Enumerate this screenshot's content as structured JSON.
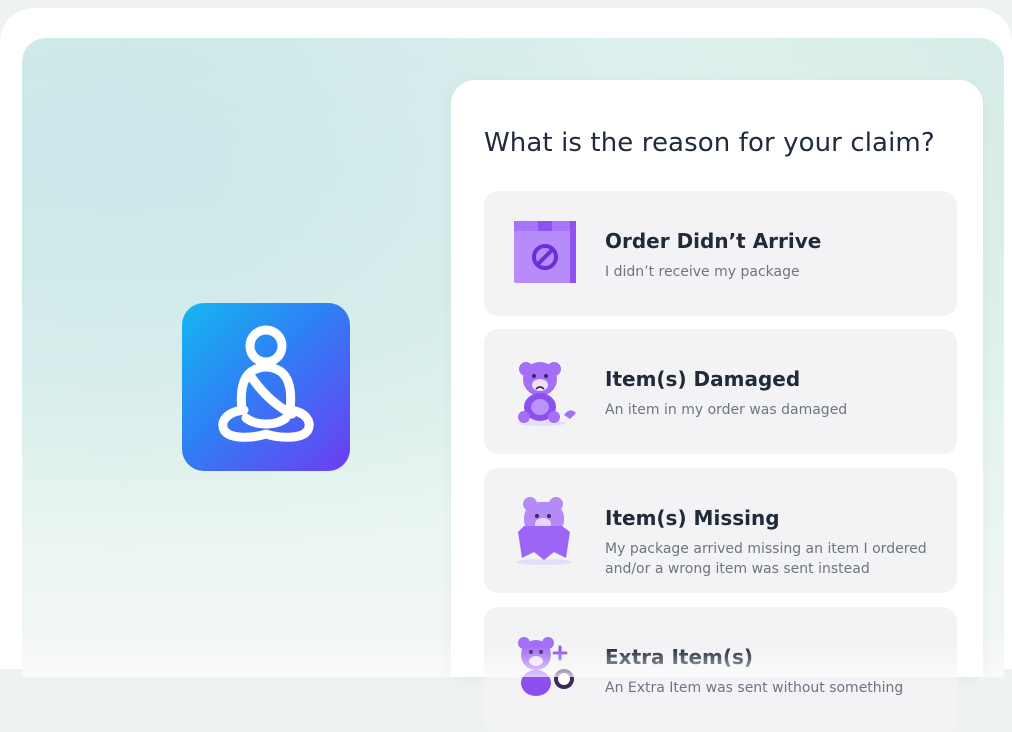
{
  "claim": {
    "question": "What is the reason for your claim?",
    "options": [
      {
        "title": "Order Didn’t Arrive",
        "description": "I didn’t receive my package",
        "icon": "package-blocked-icon"
      },
      {
        "title": "Item(s) Damaged",
        "description": "An item in my order was damaged",
        "icon": "damaged-teddy-bear-icon"
      },
      {
        "title": "Item(s) Missing",
        "description": "My package arrived missing an item I ordered and/or a wrong item was sent instead",
        "icon": "missing-teddy-bear-icon"
      },
      {
        "title": "Extra Item(s)",
        "description": "An Extra Item was sent without something",
        "icon": "extra-teddy-bear-icon"
      }
    ]
  },
  "app": {
    "icon": "meditation-person-icon"
  },
  "colors": {
    "accent_purple": "#9b5cf5",
    "icon_gradient_start": "#14b8f0",
    "icon_gradient_end": "#6d3df2",
    "card_bg": "#f3f3f5",
    "title_text": "#1f2b3a",
    "desc_text": "#6b7683"
  }
}
